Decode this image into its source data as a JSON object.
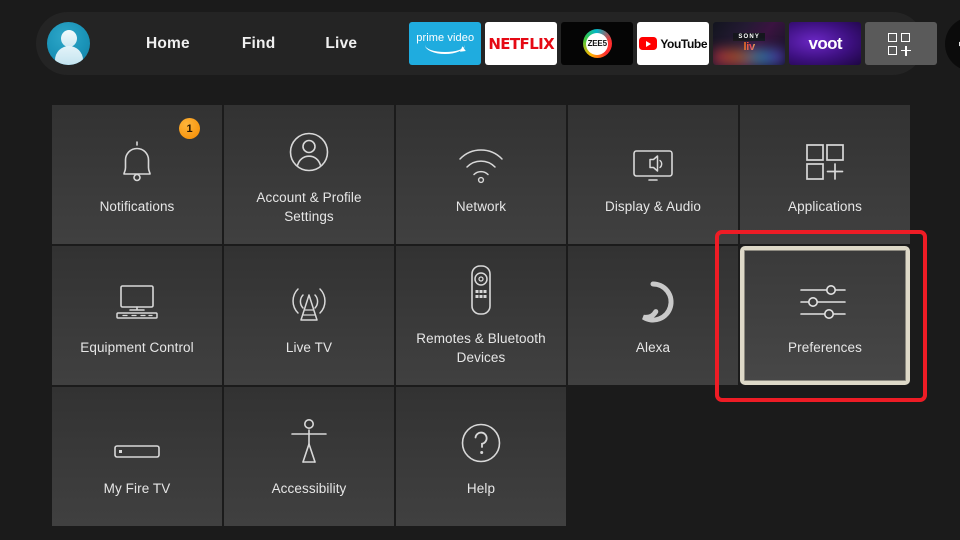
{
  "header": {
    "avatar": "profile-avatar",
    "nav": [
      {
        "id": "home",
        "label": "Home"
      },
      {
        "id": "find",
        "label": "Find"
      },
      {
        "id": "live",
        "label": "Live"
      }
    ],
    "apps": [
      {
        "id": "prime",
        "name": "prime-video-app",
        "title": "prime video"
      },
      {
        "id": "netflix",
        "name": "netflix-app",
        "title": "NETFLIX"
      },
      {
        "id": "zee5",
        "name": "zee5-app",
        "title": "ZEE5"
      },
      {
        "id": "youtube",
        "name": "youtube-app",
        "title": "YouTube"
      },
      {
        "id": "sonyliv",
        "name": "sony-liv-app",
        "title": "SONY",
        "subtitle": "liv"
      },
      {
        "id": "voot",
        "name": "voot-app",
        "title": "voot"
      }
    ],
    "apps_grid_label": "apps-grid-icon",
    "settings_label": "settings-gear-icon",
    "settings_has_notification": true
  },
  "grid": {
    "tiles": [
      {
        "id": "notifications",
        "label": "Notifications",
        "icon": "bell-icon",
        "badge": "1"
      },
      {
        "id": "account",
        "label": "Account & Profile Settings",
        "icon": "person-circle-icon"
      },
      {
        "id": "network",
        "label": "Network",
        "icon": "wifi-icon"
      },
      {
        "id": "display-audio",
        "label": "Display & Audio",
        "icon": "tv-speaker-icon"
      },
      {
        "id": "applications",
        "label": "Applications",
        "icon": "apps-squares-icon"
      },
      {
        "id": "equipment",
        "label": "Equipment Control",
        "icon": "tv-soundbar-icon"
      },
      {
        "id": "live-tv",
        "label": "Live TV",
        "icon": "antenna-icon"
      },
      {
        "id": "remotes",
        "label": "Remotes & Bluetooth Devices",
        "icon": "remote-control-icon"
      },
      {
        "id": "alexa",
        "label": "Alexa",
        "icon": "alexa-ring-icon"
      },
      {
        "id": "preferences",
        "label": "Preferences",
        "icon": "sliders-icon",
        "focused": true
      },
      {
        "id": "my-fire-tv",
        "label": "My Fire TV",
        "icon": "fire-tv-stick-icon"
      },
      {
        "id": "accessibility",
        "label": "Accessibility",
        "icon": "accessibility-person-icon"
      },
      {
        "id": "help",
        "label": "Help",
        "icon": "question-circle-icon"
      }
    ]
  },
  "colors": {
    "background": "#1b1b1b",
    "tile": "#3a3a3a",
    "accent_orange": "#ff9900",
    "focus_border": "#ded9c8",
    "annotation_red": "#ee1c25",
    "avatar_teal": "#1a93b8"
  }
}
